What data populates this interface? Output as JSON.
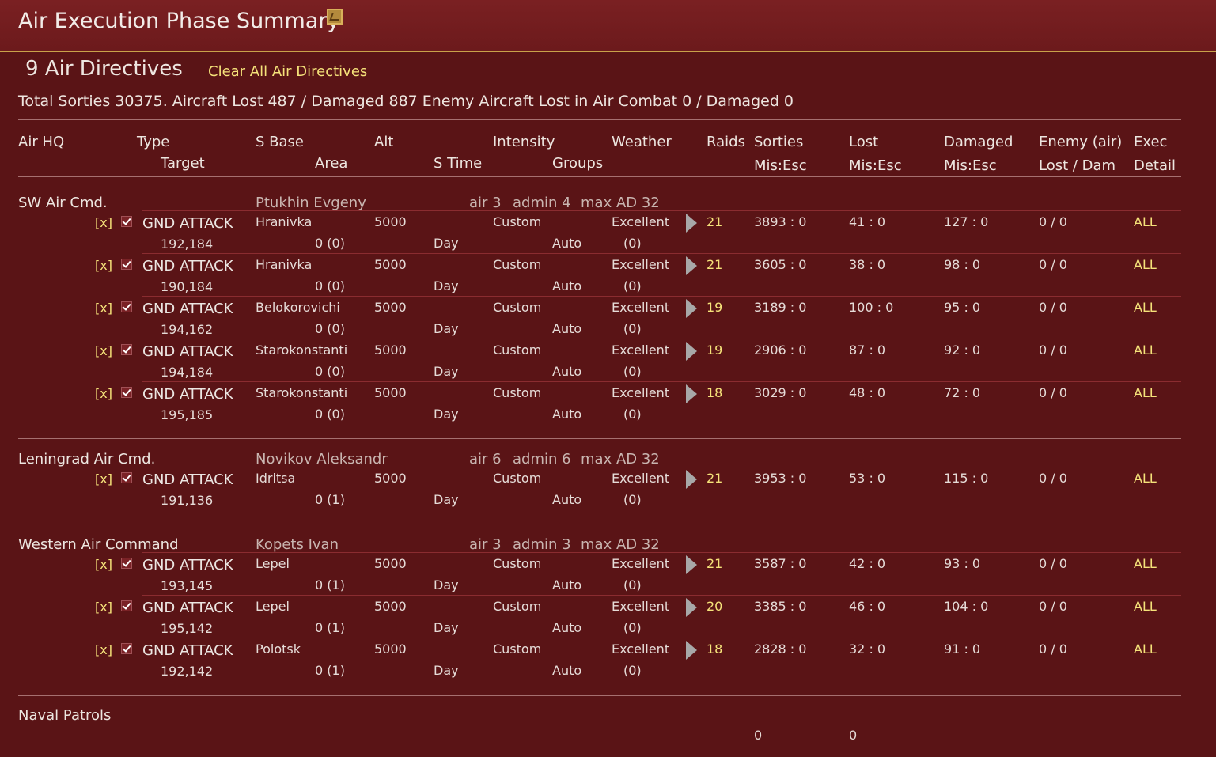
{
  "window": {
    "title": "Air Execution Phase Summary"
  },
  "summary": {
    "directives_count": "9 Air Directives",
    "clear_label": "Clear All Air Directives",
    "totals": "Total Sorties 30375. Aircraft Lost 487 / Damaged 887   Enemy Aircraft Lost in Air Combat 0 / Damaged 0"
  },
  "headers": {
    "air_hq": "Air HQ",
    "type": "Type",
    "target": "Target",
    "s_base": "S Base",
    "area": "Area",
    "alt": "Alt",
    "s_time": "S Time",
    "intensity": "Intensity",
    "groups": "Groups",
    "weather": "Weather",
    "raids": "Raids",
    "sorties": "Sorties",
    "sorties_sub": "Mis:Esc",
    "lost": "Lost",
    "lost_sub": "Mis:Esc",
    "damaged": "Damaged",
    "damaged_sub": "Mis:Esc",
    "enemy": "Enemy (air)",
    "enemy_sub": "Lost / Dam",
    "exec": "Exec",
    "exec_sub": "Detail"
  },
  "groups": [
    {
      "name": "SW Air Cmd.",
      "commander": "Ptukhin Evgeny",
      "air": "air 3",
      "admin": "admin 4",
      "max_ad": "max AD 32",
      "rows": [
        {
          "x": "[x]",
          "type": "GND ATTACK",
          "target": "192,184",
          "base": "Hranivka",
          "area": "0 (0)",
          "alt": "5000",
          "stime": "Day",
          "intensity": "Custom",
          "groups": "Auto",
          "weather": "Excellent",
          "weather2": "(0)",
          "raids": "21",
          "sorties": "3893 : 0",
          "lost": "41 : 0",
          "damaged": "127 : 0",
          "enemy": "0 / 0",
          "exec": "ALL"
        },
        {
          "x": "[x]",
          "type": "GND ATTACK",
          "target": "190,184",
          "base": "Hranivka",
          "area": "0 (0)",
          "alt": "5000",
          "stime": "Day",
          "intensity": "Custom",
          "groups": "Auto",
          "weather": "Excellent",
          "weather2": "(0)",
          "raids": "21",
          "sorties": "3605 : 0",
          "lost": "38 : 0",
          "damaged": "98 : 0",
          "enemy": "0 / 0",
          "exec": "ALL"
        },
        {
          "x": "[x]",
          "type": "GND ATTACK",
          "target": "194,162",
          "base": "Belokorovichi",
          "area": "0 (0)",
          "alt": "5000",
          "stime": "Day",
          "intensity": "Custom",
          "groups": "Auto",
          "weather": "Excellent",
          "weather2": "(0)",
          "raids": "19",
          "sorties": "3189 : 0",
          "lost": "100 : 0",
          "damaged": "95 : 0",
          "enemy": "0 / 0",
          "exec": "ALL"
        },
        {
          "x": "[x]",
          "type": "GND ATTACK",
          "target": "194,184",
          "base": "Starokonstanti",
          "area": "0 (0)",
          "alt": "5000",
          "stime": "Day",
          "intensity": "Custom",
          "groups": "Auto",
          "weather": "Excellent",
          "weather2": "(0)",
          "raids": "19",
          "sorties": "2906 : 0",
          "lost": "87 : 0",
          "damaged": "92 : 0",
          "enemy": "0 / 0",
          "exec": "ALL"
        },
        {
          "x": "[x]",
          "type": "GND ATTACK",
          "target": "195,185",
          "base": "Starokonstanti",
          "area": "0 (0)",
          "alt": "5000",
          "stime": "Day",
          "intensity": "Custom",
          "groups": "Auto",
          "weather": "Excellent",
          "weather2": "(0)",
          "raids": "18",
          "sorties": "3029 : 0",
          "lost": "48 : 0",
          "damaged": "72 : 0",
          "enemy": "0 / 0",
          "exec": "ALL"
        }
      ]
    },
    {
      "name": "Leningrad Air Cmd.",
      "commander": "Novikov Aleksandr",
      "air": "air 6",
      "admin": "admin 6",
      "max_ad": "max AD 32",
      "rows": [
        {
          "x": "[x]",
          "type": "GND ATTACK",
          "target": "191,136",
          "base": "Idritsa",
          "area": "0 (1)",
          "alt": "5000",
          "stime": "Day",
          "intensity": "Custom",
          "groups": "Auto",
          "weather": "Excellent",
          "weather2": "(0)",
          "raids": "21",
          "sorties": "3953 : 0",
          "lost": "53 : 0",
          "damaged": "115 : 0",
          "enemy": "0 / 0",
          "exec": "ALL"
        }
      ]
    },
    {
      "name": "Western Air Command",
      "commander": "Kopets Ivan",
      "air": "air 3",
      "admin": "admin 3",
      "max_ad": "max AD 32",
      "rows": [
        {
          "x": "[x]",
          "type": "GND ATTACK",
          "target": "193,145",
          "base": "Lepel",
          "area": "0 (1)",
          "alt": "5000",
          "stime": "Day",
          "intensity": "Custom",
          "groups": "Auto",
          "weather": "Excellent",
          "weather2": "(0)",
          "raids": "21",
          "sorties": "3587 : 0",
          "lost": "42 : 0",
          "damaged": "93 : 0",
          "enemy": "0 / 0",
          "exec": "ALL"
        },
        {
          "x": "[x]",
          "type": "GND ATTACK",
          "target": "195,142",
          "base": "Lepel",
          "area": "0 (1)",
          "alt": "5000",
          "stime": "Day",
          "intensity": "Custom",
          "groups": "Auto",
          "weather": "Excellent",
          "weather2": "(0)",
          "raids": "20",
          "sorties": "3385 : 0",
          "lost": "46 : 0",
          "damaged": "104 : 0",
          "enemy": "0 / 0",
          "exec": "ALL"
        },
        {
          "x": "[x]",
          "type": "GND ATTACK",
          "target": "192,142",
          "base": "Polotsk",
          "area": "0 (1)",
          "alt": "5000",
          "stime": "Day",
          "intensity": "Custom",
          "groups": "Auto",
          "weather": "Excellent",
          "weather2": "(0)",
          "raids": "18",
          "sorties": "2828 : 0",
          "lost": "32 : 0",
          "damaged": "91 : 0",
          "enemy": "0 / 0",
          "exec": "ALL"
        }
      ]
    }
  ],
  "naval": {
    "label": "Naval Patrols",
    "sorties": "0",
    "lost": "0"
  },
  "colors": {
    "background": "#5a1416",
    "titlebar": "#721c1e",
    "accent_yellow": "#f5e27a",
    "gold_border": "#c9a24a"
  }
}
